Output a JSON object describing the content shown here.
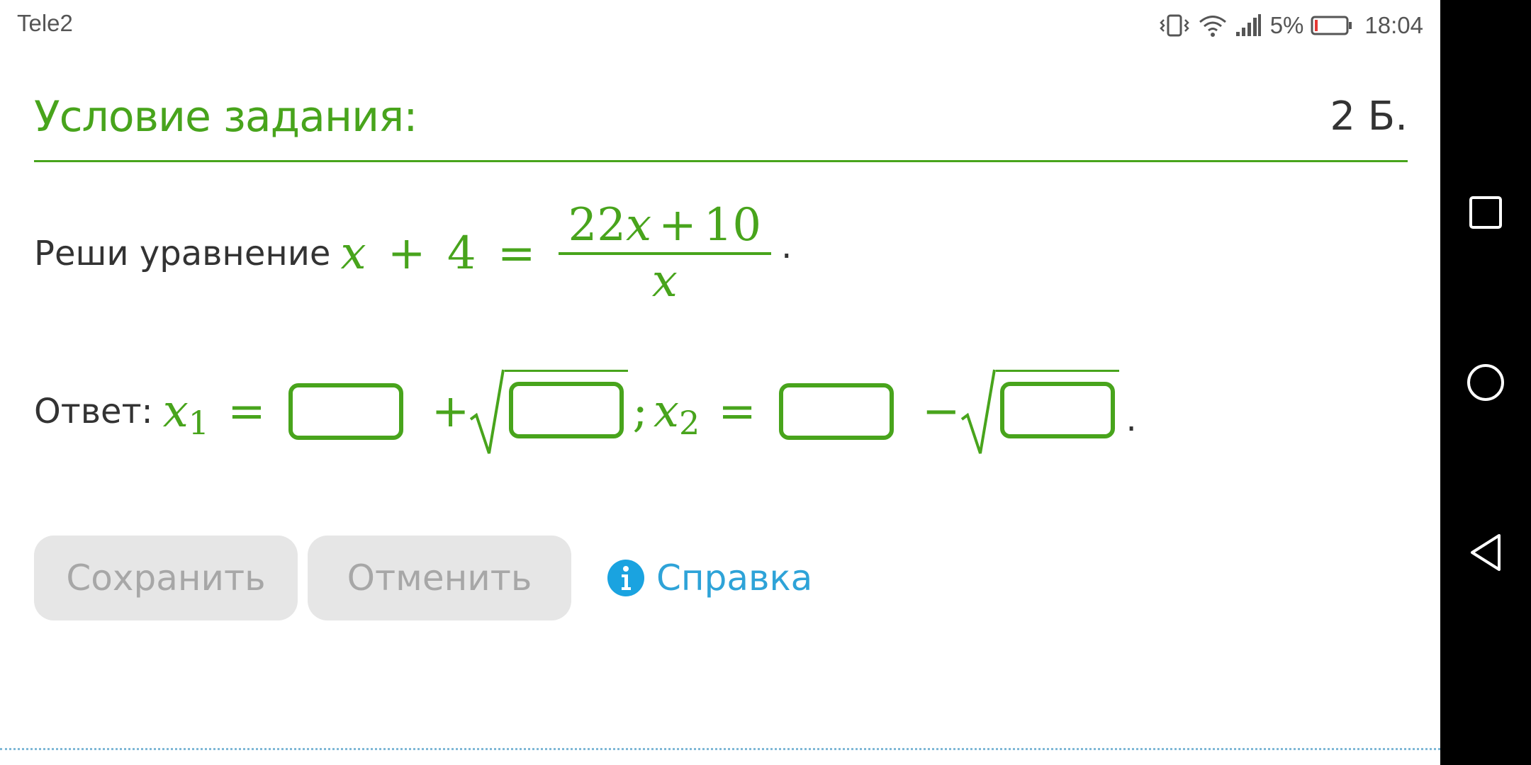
{
  "status_bar": {
    "carrier": "Tele2",
    "battery_percent": "5%",
    "time": "18:04"
  },
  "task": {
    "title": "Условие задания:",
    "points": "2 Б."
  },
  "problem": {
    "prompt": "Реши уравнение",
    "lhs_var": "x",
    "lhs_op": "+",
    "lhs_const": "4",
    "equals": "=",
    "numerator_coef": "22",
    "numerator_var": "x",
    "numerator_op": "+",
    "numerator_const": "10",
    "denominator": "x",
    "period": "."
  },
  "answer": {
    "label": "Ответ:",
    "x1_var": "x",
    "x1_sub": "1",
    "x2_var": "x",
    "x2_sub": "2",
    "equals": "=",
    "plus": "+",
    "minus": "−",
    "separator": ";",
    "period": "."
  },
  "actions": {
    "save_label": "Сохранить",
    "cancel_label": "Отменить",
    "help_label": "Справка"
  },
  "colors": {
    "accent_green": "#48a41c",
    "link_blue": "#2ea3d8",
    "button_bg": "#e6e6e6",
    "button_text": "#a7a7a7"
  }
}
